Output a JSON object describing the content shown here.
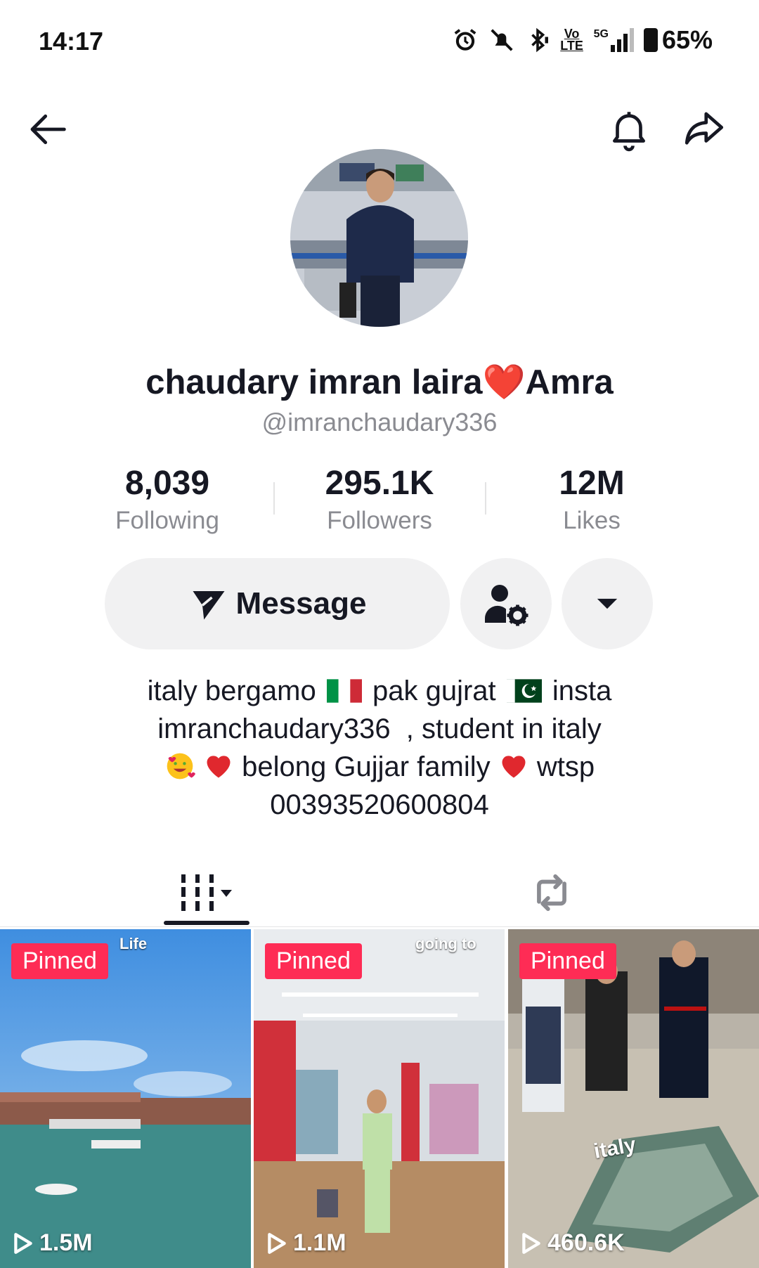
{
  "status_bar": {
    "time": "14:17",
    "icons": [
      "alarm-icon",
      "mute-icon",
      "bluetooth-icon",
      "volte-icon",
      "signal-5g-icon",
      "battery-icon"
    ],
    "volte": "Vo LTE",
    "network": "5G",
    "battery": "65%"
  },
  "header": {
    "back_icon": "arrow-left-icon",
    "notify_icon": "bell-icon",
    "share_icon": "share-icon"
  },
  "profile": {
    "display_name": "chaudary imran laira❤️Amra",
    "handle": "@imranchaudary336"
  },
  "stats": [
    {
      "value": "8,039",
      "label": "Following"
    },
    {
      "value": "295.1K",
      "label": "Followers"
    },
    {
      "value": "12M",
      "label": "Likes"
    }
  ],
  "actions": {
    "message_label": "Message",
    "message_icon": "send-icon",
    "friends_icon": "person-settings-icon",
    "more_icon": "caret-down-icon"
  },
  "bio": {
    "line1_a": "italy bergamo",
    "line1_b": "pak gujrat",
    "line1_c": "insta",
    "line2": "imranchaudary336  , student in italy",
    "line3": "belong Gujjar family",
    "line3_b": "wtsp",
    "line4": "00393520600804"
  },
  "tabs": [
    {
      "name": "videos",
      "icon": "grid-icon"
    },
    {
      "name": "reposts",
      "icon": "repost-icon"
    }
  ],
  "videos": [
    {
      "badge": "Pinned",
      "views": "1.5M",
      "caption": "Life"
    },
    {
      "badge": "Pinned",
      "views": "1.1M",
      "caption": "going to"
    },
    {
      "badge": "Pinned",
      "views": "460.6K",
      "caption": "italy"
    }
  ],
  "colors": {
    "accent": "#fe2c55",
    "secondary_text": "#8a8b91",
    "button_bg": "#f1f1f2"
  }
}
